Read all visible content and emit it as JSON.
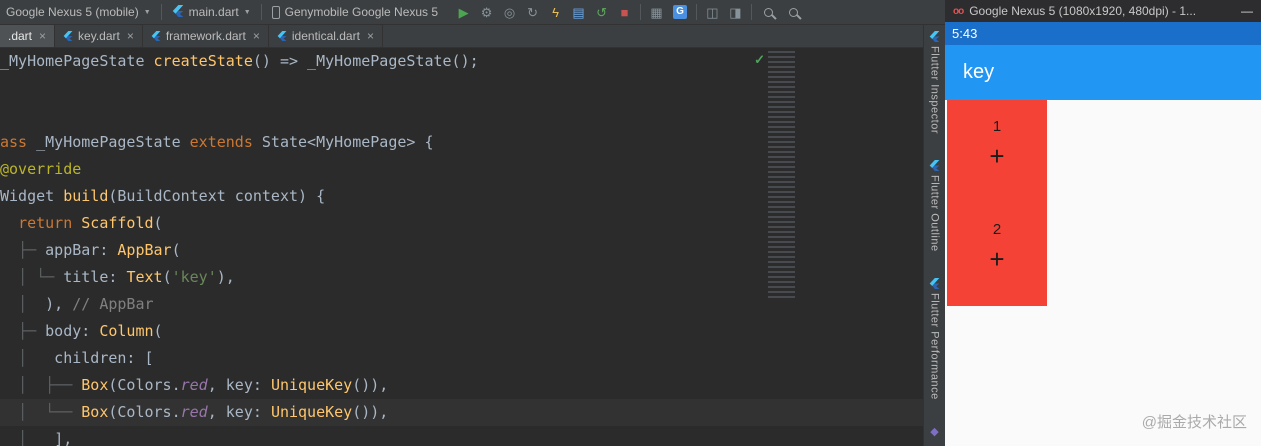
{
  "colors": {
    "app_bar": "#2196f3",
    "status_bar": "#1a6fca",
    "box_red": "#f44336",
    "run_green": "#4ca551",
    "stop_red": "#c75450",
    "hot_reload_yellow": "#e8bf5a"
  },
  "toolbar": {
    "device_selector": "Google Nexus 5 (mobile)",
    "config_selector": "main.dart",
    "target_selector": "Genymobile Google Nexus 5",
    "arrow": "▼",
    "icons": [
      {
        "name": "run-icon",
        "glyph": "▶",
        "color": "#4ca551"
      },
      {
        "name": "attach-debugger-icon",
        "glyph": "⚙",
        "color": "#87939a"
      },
      {
        "name": "profiler-icon",
        "glyph": "◎",
        "color": "#87939a"
      },
      {
        "name": "rerun-icon",
        "glyph": "↻",
        "color": "#87939a"
      },
      {
        "name": "hot-reload-icon",
        "glyph": "ϟ",
        "color": "#e8bf5a"
      },
      {
        "name": "open-devtools-icon",
        "glyph": "▤",
        "color": "#6ba6e8"
      },
      {
        "name": "hot-restart-icon",
        "glyph": "↺",
        "color": "#5da75d"
      },
      {
        "name": "stop-icon",
        "glyph": "■",
        "color": "#c75450"
      },
      {
        "type": "sep"
      },
      {
        "name": "device-file-explorer-icon",
        "glyph": "▦",
        "color": "#87939a"
      },
      {
        "name": "translate-icon",
        "glyph": "G",
        "color": "#ffffff",
        "boxed": true,
        "bg": "#4a8fe0"
      },
      {
        "type": "sep"
      },
      {
        "name": "layout-inspector-icon",
        "glyph": "◫",
        "color": "#87939a"
      },
      {
        "name": "screen-capture-icon",
        "glyph": "◨",
        "color": "#87939a"
      },
      {
        "type": "sep"
      },
      {
        "name": "find-action-icon",
        "shape": "mag"
      },
      {
        "name": "search-everywhere-icon",
        "shape": "mag"
      }
    ]
  },
  "tabs": [
    {
      "label": ".dart",
      "icon": false,
      "active": true,
      "close": "×"
    },
    {
      "label": "key.dart",
      "icon": true,
      "active": false,
      "close": "×"
    },
    {
      "label": "framework.dart",
      "icon": true,
      "active": false,
      "close": "×"
    },
    {
      "label": "identical.dart",
      "icon": true,
      "active": false,
      "close": "×"
    }
  ],
  "editor": {
    "check_icon": "✓",
    "highlight_line": 13,
    "lines": [
      [
        [
          "pln",
          "_MyHomePageState "
        ],
        [
          "fn",
          "createState"
        ],
        [
          "pln",
          "() => _MyHomePageState();"
        ]
      ],
      [],
      [],
      [
        [
          "kw",
          "ass"
        ],
        [
          "pln",
          " _MyHomePageState "
        ],
        [
          "kw",
          "extends"
        ],
        [
          "pln",
          " State<MyHomePage> {"
        ]
      ],
      [
        [
          "ann",
          "@override"
        ]
      ],
      [
        [
          "pln",
          "Widget "
        ],
        [
          "fn",
          "build"
        ],
        [
          "pln",
          "(BuildContext context) {"
        ]
      ],
      [
        [
          "pln",
          "  "
        ],
        [
          "kw",
          "return"
        ],
        [
          "pln",
          " "
        ],
        [
          "cls",
          "Scaffold"
        ],
        [
          "pln",
          "("
        ]
      ],
      [
        [
          "pln",
          "  "
        ],
        [
          "guide",
          "├─ "
        ],
        [
          "pln",
          "appBar: "
        ],
        [
          "cls",
          "AppBar"
        ],
        [
          "pln",
          "("
        ]
      ],
      [
        [
          "pln",
          "  "
        ],
        [
          "guide",
          "│ └─ "
        ],
        [
          "pln",
          "title: "
        ],
        [
          "cls",
          "Text"
        ],
        [
          "pln",
          "("
        ],
        [
          "str",
          "'key'"
        ],
        [
          "pln",
          "),"
        ]
      ],
      [
        [
          "pln",
          "  "
        ],
        [
          "guide",
          "│  "
        ],
        [
          "pln",
          "), "
        ],
        [
          "cmt",
          "// AppBar"
        ]
      ],
      [
        [
          "pln",
          "  "
        ],
        [
          "guide",
          "├─ "
        ],
        [
          "pln",
          "body: "
        ],
        [
          "cls",
          "Column"
        ],
        [
          "pln",
          "("
        ]
      ],
      [
        [
          "pln",
          "  "
        ],
        [
          "guide",
          "│ "
        ],
        [
          "pln",
          "  children: ["
        ]
      ],
      [
        [
          "pln",
          "  "
        ],
        [
          "guide",
          "│  ├── "
        ],
        [
          "cls",
          "Box"
        ],
        [
          "pln",
          "(Colors."
        ],
        [
          "fld",
          "red"
        ],
        [
          "pln",
          ", key: "
        ],
        [
          "cls",
          "UniqueKey"
        ],
        [
          "pln",
          "()),"
        ]
      ],
      [
        [
          "pln",
          "  "
        ],
        [
          "guide",
          "│  └── "
        ],
        [
          "cls",
          "Box"
        ],
        [
          "pln",
          "(Colors."
        ],
        [
          "fld",
          "red"
        ],
        [
          "pln",
          ", key: "
        ],
        [
          "cls",
          "UniqueKey"
        ],
        [
          "pln",
          "()),"
        ]
      ],
      [
        [
          "pln",
          "  "
        ],
        [
          "guide",
          "│   "
        ],
        [
          "pln",
          "],"
        ]
      ]
    ]
  },
  "right_stripe": {
    "items": [
      {
        "label": "Flutter Inspector"
      },
      {
        "label": "Flutter Outline"
      },
      {
        "label": "Flutter Performance"
      }
    ],
    "bottom_icon": {
      "name": "bottom-tool-icon",
      "glyph": "◆",
      "color": "#7f6fc4"
    }
  },
  "device": {
    "title": "Google Nexus 5 (1080x1920, 480dpi) - 1...",
    "minimize": "—",
    "status_time": "5:43",
    "appbar_title": "key",
    "cells": [
      {
        "number": "1",
        "plus": "+"
      },
      {
        "number": "2",
        "plus": "+"
      }
    ],
    "watermark": "@掘金技术社区"
  }
}
